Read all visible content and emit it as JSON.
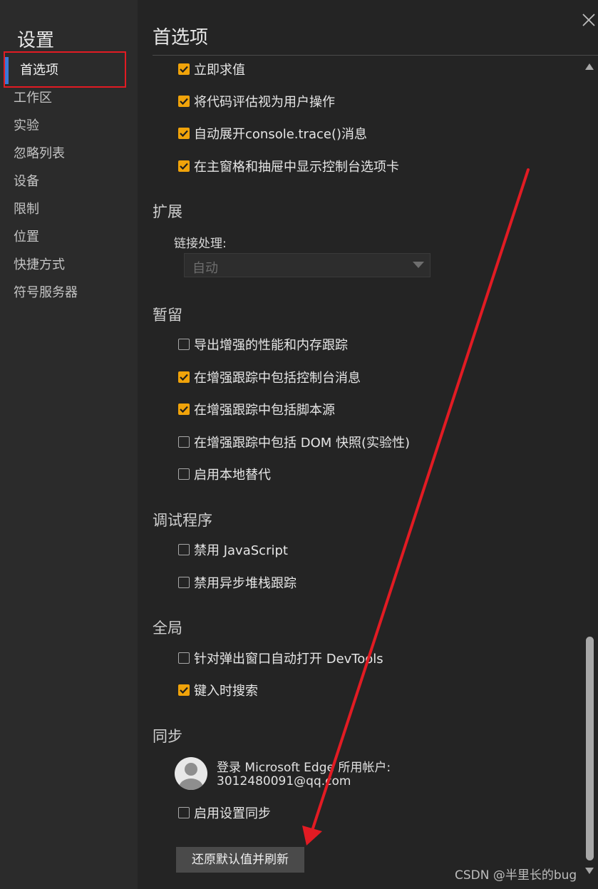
{
  "sidebar": {
    "title": "设置",
    "items": [
      {
        "label": "首选项",
        "active": true
      },
      {
        "label": "工作区"
      },
      {
        "label": "实验"
      },
      {
        "label": "忽略列表"
      },
      {
        "label": "设备"
      },
      {
        "label": "限制"
      },
      {
        "label": "位置"
      },
      {
        "label": "快捷方式"
      },
      {
        "label": "符号服务器"
      }
    ]
  },
  "main": {
    "title": "首选项",
    "console_options": [
      {
        "label": "立即求值",
        "checked": true
      },
      {
        "label": "将代码评估视为用户操作",
        "checked": true
      },
      {
        "label": "自动展开console.trace()消息",
        "checked": true
      },
      {
        "label": "在主窗格和抽屉中显示控制台选项卡",
        "checked": true
      }
    ],
    "extensions": {
      "heading": "扩展",
      "link_label": "链接处理:",
      "link_value": "自动"
    },
    "persistence": {
      "heading": "暂留",
      "options": [
        {
          "label": "导出增强的性能和内存跟踪",
          "checked": false
        },
        {
          "label": "在增强跟踪中包括控制台消息",
          "checked": true
        },
        {
          "label": "在增强跟踪中包括脚本源",
          "checked": true
        },
        {
          "label": "在增强跟踪中包括 DOM 快照(实验性)",
          "checked": false
        },
        {
          "label": "启用本地替代",
          "checked": false
        }
      ]
    },
    "debugger": {
      "heading": "调试程序",
      "options": [
        {
          "label": "禁用 JavaScript",
          "checked": false
        },
        {
          "label": "禁用异步堆栈跟踪",
          "checked": false
        }
      ]
    },
    "global": {
      "heading": "全局",
      "options": [
        {
          "label": "针对弹出窗口自动打开 DevTools",
          "checked": false
        },
        {
          "label": "键入时搜索",
          "checked": true
        }
      ]
    },
    "sync": {
      "heading": "同步",
      "account_line1": "登录 Microsoft Edge 所用帐户:",
      "account_line2": "3012480091@qq.com",
      "enable_label": "启用设置同步",
      "enable_checked": false
    },
    "reset_button": "还原默认值并刷新"
  },
  "watermark": "CSDN @半里长的bug",
  "colors": {
    "checkbox_checked": "#f0a30a",
    "sidebar_active_bar": "#3b78d8",
    "annotation_red": "#e21b23"
  }
}
